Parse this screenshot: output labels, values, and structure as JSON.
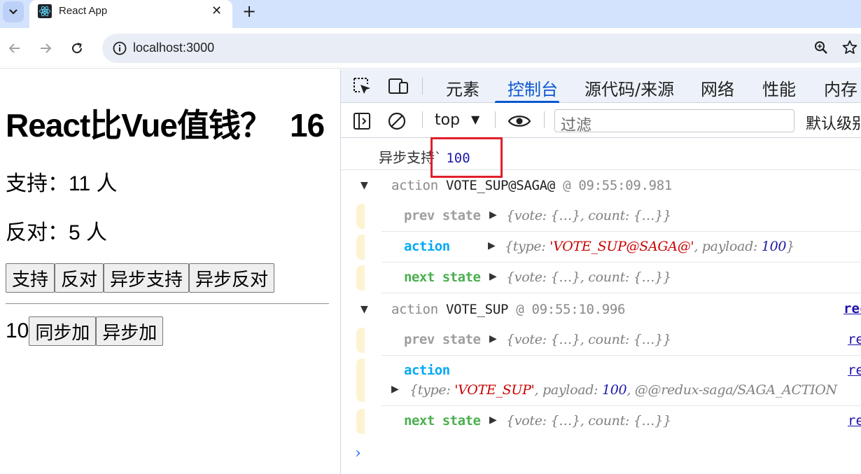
{
  "browser": {
    "tab_title": "React App",
    "tab_close": "✕",
    "new_tab": "+",
    "url": "localhost:3000"
  },
  "page": {
    "heading_text": "React比Vue值钱？",
    "heading_total": "16",
    "support_line": "支持：11 人",
    "oppose_line": "反对：5 人",
    "buttons": [
      "支持",
      "反对",
      "异步支持",
      "异步反对"
    ],
    "count": "10",
    "count_buttons": [
      "同步加",
      "异步加"
    ]
  },
  "devtools": {
    "tabs": [
      "元素",
      "控制台",
      "源代码/来源",
      "网络",
      "性能",
      "内存"
    ],
    "active_tab": "控制台",
    "context": "top",
    "filter_placeholder": "过滤",
    "levels": "默认级别",
    "console": {
      "log_text": "异步支持`",
      "log_value": "100",
      "groups": [
        {
          "prefix": "action",
          "type": "VOTE_SUP@SAGA@",
          "time": "@ 09:55:09.981",
          "link": "",
          "prev_label": "prev state",
          "prev_value": "{vote: {…}, count: {…}}",
          "action_label": "action",
          "action_key1": "{type: ",
          "action_str": "'VOTE_SUP@SAGA@'",
          "action_key2": ", payload: ",
          "action_num": "100",
          "action_end": "}",
          "next_label": "next state",
          "next_value": "{vote: {…}, count: {…}}"
        },
        {
          "prefix": "action",
          "type": "VOTE_SUP",
          "time": "@ 09:55:10.996",
          "link": "rec",
          "row_link": "re",
          "prev_label": "prev state",
          "prev_value": "{vote: {…}, count: {…}}",
          "action_label": "action",
          "action_key1": "{type: ",
          "action_str": "'VOTE_SUP'",
          "action_key2": ", payload: ",
          "action_num": "100",
          "action_end": ",  @@redux-saga/SAGA_ACTION",
          "next_label": "next state",
          "next_value": "{vote: {…}, count: {…}}"
        }
      ]
    },
    "prompt": "›"
  }
}
